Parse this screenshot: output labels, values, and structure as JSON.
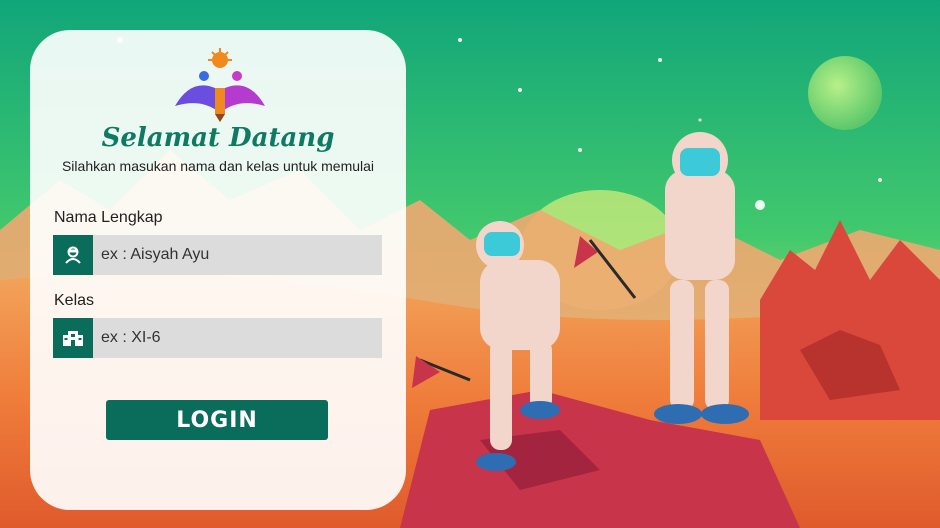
{
  "login_card": {
    "title": "Selamat Datang",
    "subtitle": "Silahkan masukan nama dan kelas untuk memulai",
    "name_field": {
      "label": "Nama Lengkap",
      "placeholder": "ex : Aisyah Ayu",
      "value": "",
      "icon": "user-icon"
    },
    "class_field": {
      "label": "Kelas",
      "placeholder": "ex : XI-6",
      "value": "",
      "icon": "building-icon"
    },
    "login_button": "LOGIN"
  },
  "colors": {
    "accent": "#0a6c5a",
    "title": "#0f7a63"
  }
}
